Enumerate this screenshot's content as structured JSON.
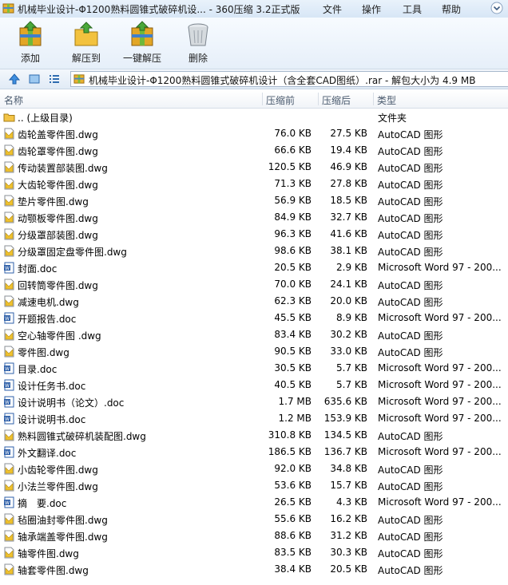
{
  "window": {
    "title": "机械毕业设计-Φ1200熟料圆锥式破碎机设... - 360压缩 3.2正式版",
    "menus": [
      "文件",
      "操作",
      "工具",
      "帮助"
    ]
  },
  "toolbar": {
    "add": "添加",
    "extract_to": "解压到",
    "one_click_extract": "一键解压",
    "delete": "删除"
  },
  "address": {
    "path": "机械毕业设计-Φ1200熟料圆锥式破碎机设计（含全套CAD图纸）.rar - 解包大小为 4.9 MB"
  },
  "columns": {
    "name": "名称",
    "size": "压缩前",
    "packed": "压缩后",
    "type": "类型"
  },
  "files": [
    {
      "name": ".. (上级目录)",
      "size": "",
      "packed": "",
      "type": "文件夹",
      "kind": "folder"
    },
    {
      "name": "齿轮盖零件图.dwg",
      "size": "76.0 KB",
      "packed": "27.5 KB",
      "type": "AutoCAD 图形",
      "kind": "dwg"
    },
    {
      "name": "齿轮罩零件图.dwg",
      "size": "66.6 KB",
      "packed": "19.4 KB",
      "type": "AutoCAD 图形",
      "kind": "dwg"
    },
    {
      "name": "传动装置部装图.dwg",
      "size": "120.5 KB",
      "packed": "46.9 KB",
      "type": "AutoCAD 图形",
      "kind": "dwg"
    },
    {
      "name": "大齿轮零件图.dwg",
      "size": "71.3 KB",
      "packed": "27.8 KB",
      "type": "AutoCAD 图形",
      "kind": "dwg"
    },
    {
      "name": "垫片零件图.dwg",
      "size": "56.9 KB",
      "packed": "18.5 KB",
      "type": "AutoCAD 图形",
      "kind": "dwg"
    },
    {
      "name": "动颚板零件图.dwg",
      "size": "84.9 KB",
      "packed": "32.7 KB",
      "type": "AutoCAD 图形",
      "kind": "dwg"
    },
    {
      "name": "分级罩部装图.dwg",
      "size": "96.3 KB",
      "packed": "41.6 KB",
      "type": "AutoCAD 图形",
      "kind": "dwg"
    },
    {
      "name": "分级罩固定盘零件图.dwg",
      "size": "98.6 KB",
      "packed": "38.1 KB",
      "type": "AutoCAD 图形",
      "kind": "dwg"
    },
    {
      "name": "封面.doc",
      "size": "20.5 KB",
      "packed": "2.9 KB",
      "type": "Microsoft Word 97 - 200...",
      "kind": "doc"
    },
    {
      "name": "回转筒零件图.dwg",
      "size": "70.0 KB",
      "packed": "24.1 KB",
      "type": "AutoCAD 图形",
      "kind": "dwg"
    },
    {
      "name": "减速电机.dwg",
      "size": "62.3 KB",
      "packed": "20.0 KB",
      "type": "AutoCAD 图形",
      "kind": "dwg"
    },
    {
      "name": "开题报告.doc",
      "size": "45.5 KB",
      "packed": "8.9 KB",
      "type": "Microsoft Word 97 - 200...",
      "kind": "doc"
    },
    {
      "name": "空心轴零件图 .dwg",
      "size": "83.4 KB",
      "packed": "30.2 KB",
      "type": "AutoCAD 图形",
      "kind": "dwg"
    },
    {
      "name": "零件图.dwg",
      "size": "90.5 KB",
      "packed": "33.0 KB",
      "type": "AutoCAD 图形",
      "kind": "dwg"
    },
    {
      "name": "目录.doc",
      "size": "30.5 KB",
      "packed": "5.7 KB",
      "type": "Microsoft Word 97 - 200...",
      "kind": "doc"
    },
    {
      "name": "设计任务书.doc",
      "size": "40.5 KB",
      "packed": "5.7 KB",
      "type": "Microsoft Word 97 - 200...",
      "kind": "doc"
    },
    {
      "name": "设计说明书（论文）.doc",
      "size": "1.7 MB",
      "packed": "635.6 KB",
      "type": "Microsoft Word 97 - 200...",
      "kind": "doc"
    },
    {
      "name": "设计说明书.doc",
      "size": "1.2 MB",
      "packed": "153.9 KB",
      "type": "Microsoft Word 97 - 200...",
      "kind": "doc"
    },
    {
      "name": "熟料圆锥式破碎机装配图.dwg",
      "size": "310.8 KB",
      "packed": "134.5 KB",
      "type": "AutoCAD 图形",
      "kind": "dwg"
    },
    {
      "name": "外文翻译.doc",
      "size": "186.5 KB",
      "packed": "136.7 KB",
      "type": "Microsoft Word 97 - 200...",
      "kind": "doc"
    },
    {
      "name": "小齿轮零件图.dwg",
      "size": "92.0 KB",
      "packed": "34.8 KB",
      "type": "AutoCAD 图形",
      "kind": "dwg"
    },
    {
      "name": "小法兰零件图.dwg",
      "size": "53.6 KB",
      "packed": "15.7 KB",
      "type": "AutoCAD 图形",
      "kind": "dwg"
    },
    {
      "name": "摘　要.doc",
      "size": "26.5 KB",
      "packed": "4.3 KB",
      "type": "Microsoft Word 97 - 200...",
      "kind": "doc"
    },
    {
      "name": "毡圈油封零件图.dwg",
      "size": "55.6 KB",
      "packed": "16.2 KB",
      "type": "AutoCAD 图形",
      "kind": "dwg"
    },
    {
      "name": "轴承端盖零件图.dwg",
      "size": "88.6 KB",
      "packed": "31.2 KB",
      "type": "AutoCAD 图形",
      "kind": "dwg"
    },
    {
      "name": "轴零件图.dwg",
      "size": "83.5 KB",
      "packed": "30.3 KB",
      "type": "AutoCAD 图形",
      "kind": "dwg"
    },
    {
      "name": "轴套零件图.dwg",
      "size": "38.4 KB",
      "packed": "20.5 KB",
      "type": "AutoCAD 图形",
      "kind": "dwg"
    }
  ]
}
